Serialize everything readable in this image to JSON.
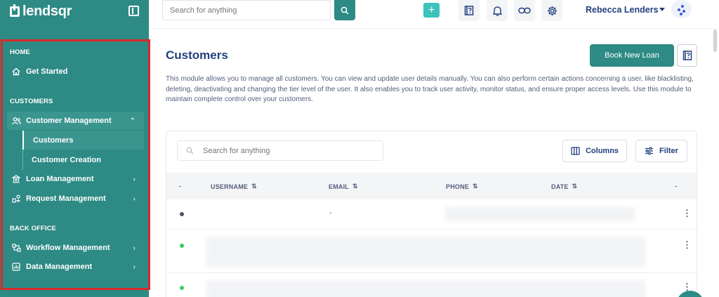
{
  "app": {
    "brand": "lendsqr"
  },
  "sidebar": {
    "sections": [
      {
        "label": "HOME"
      },
      {
        "label": "CUSTOMERS"
      },
      {
        "label": "BACK OFFICE"
      }
    ],
    "items": [
      {
        "label": "Get Started",
        "icon": "home-icon"
      },
      {
        "label": "Customer Management",
        "icon": "users-icon",
        "expanded": true
      },
      {
        "label": "Loan Management",
        "icon": "bank-icon"
      },
      {
        "label": "Request Management",
        "icon": "request-icon"
      },
      {
        "label": "Workflow Management",
        "icon": "workflow-icon"
      },
      {
        "label": "Data Management",
        "icon": "chart-icon"
      }
    ],
    "sub_items": [
      {
        "label": "Customers",
        "active": true
      },
      {
        "label": "Customer Creation",
        "active": false
      }
    ],
    "accent": "#2d8a84",
    "highlight_border": "#d82a2a"
  },
  "header": {
    "search_placeholder": "Search for anything",
    "user_name": "Rebecca Lenders",
    "icons": [
      "add-icon",
      "help-book-icon",
      "bell-icon",
      "link-icon",
      "gear-icon"
    ]
  },
  "main": {
    "title": "Customers",
    "book_button": "Book New Loan",
    "description": "This module allows you to manage all customers. You can view and update user details manually. You can also perform certain actions concerning a user, like blacklisting, deleting, deactivating and changing the tier level of the user. It also enables you to track user activity, monitor status, and ensure proper access levels. Use this module to maintain complete control over your customers.",
    "table": {
      "search_placeholder": "Search for anything",
      "columns_button": "Columns",
      "filter_button": "Filter",
      "headers": [
        "-",
        "USERNAME",
        "EMAIL",
        "PHONE",
        "DATE",
        "-"
      ],
      "rows": [
        {
          "status_color": "#4a5568",
          "email": "-"
        },
        {
          "status_color": "#39cd62",
          "email": ""
        },
        {
          "status_color": "#39cd62",
          "email": ""
        }
      ]
    }
  }
}
